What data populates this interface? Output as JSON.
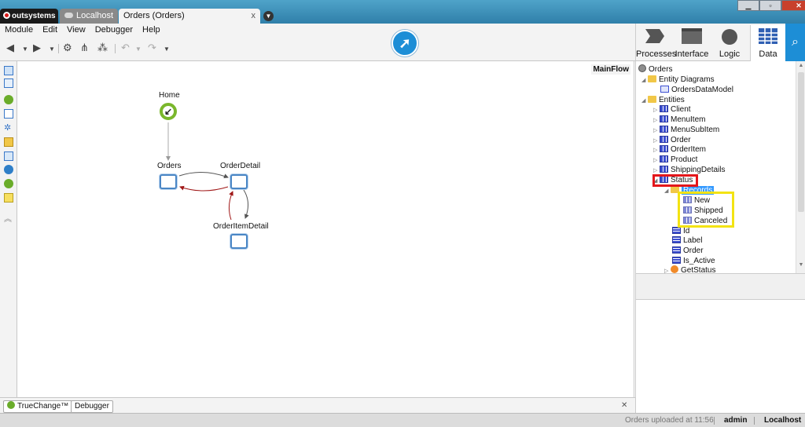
{
  "titlebar": {
    "brand": "outsystems",
    "tabs": [
      {
        "label": "Localhost"
      },
      {
        "label": "Orders (Orders)",
        "close": "x"
      }
    ]
  },
  "menu": [
    "Module",
    "Edit",
    "View",
    "Debugger",
    "Help"
  ],
  "right_tabs": [
    {
      "label": "Processes"
    },
    {
      "label": "Interface"
    },
    {
      "label": "Logic"
    },
    {
      "label": "Data"
    }
  ],
  "canvas": {
    "flow_name": "MainFlow",
    "nodes": {
      "home": "Home",
      "orders": "Orders",
      "order_detail": "OrderDetail",
      "order_item_detail": "OrderItemDetail"
    }
  },
  "tree": {
    "root": "Orders",
    "entity_diagrams": "Entity Diagrams",
    "data_model": "OrdersDataModel",
    "entities": "Entities",
    "entity_list": [
      "Client",
      "MenuItem",
      "MenuSubItem",
      "Order",
      "OrderItem",
      "Product",
      "ShippingDetails",
      "Status"
    ],
    "records": "Records",
    "record_list": [
      "New",
      "Shipped",
      "Canceled"
    ],
    "attributes": [
      "Id",
      "Label",
      "Order",
      "Is_Active"
    ],
    "action": "GetStatus"
  },
  "bottom_tabs": [
    "TrueChange™",
    "Debugger"
  ],
  "status": {
    "message": "Orders uploaded at 11:56",
    "user": "admin",
    "server": "Localhost"
  },
  "colors": {
    "accent": "#1d8ed6",
    "highlight_red": "#e4161b",
    "highlight_yellow": "#f3e313"
  }
}
